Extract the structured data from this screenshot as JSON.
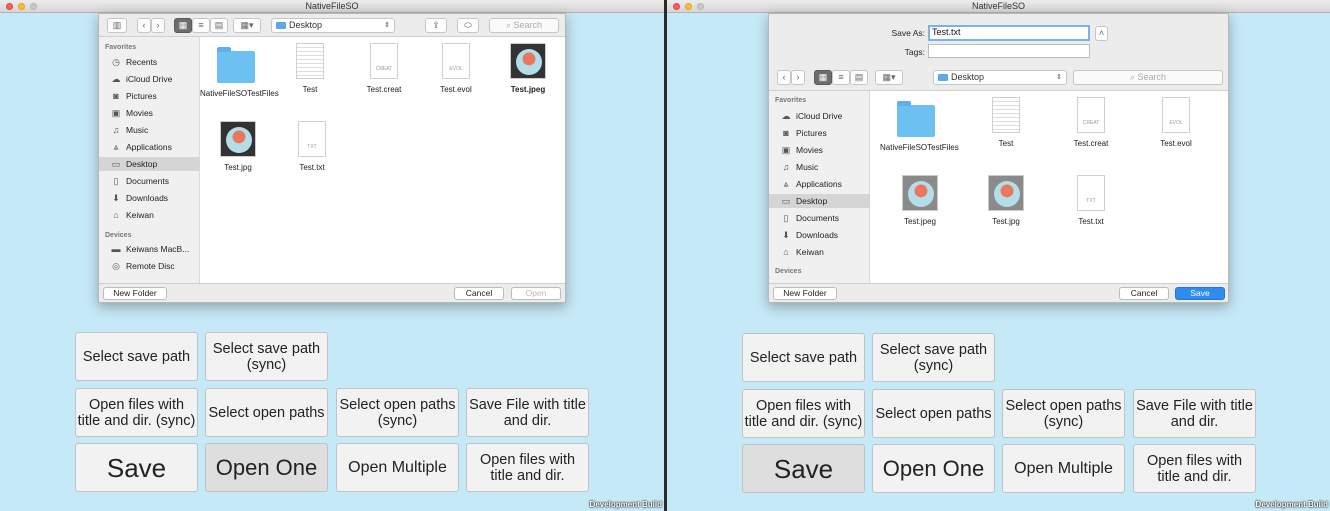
{
  "app_title": "NativeFileSO",
  "dev_build": "Development Build",
  "open_dialog": {
    "location": "Desktop",
    "search_placeholder": "Search",
    "sidebar": {
      "favorites_header": "Favorites",
      "favorites": [
        "Recents",
        "iCloud Drive",
        "Pictures",
        "Movies",
        "Music",
        "Applications",
        "Desktop",
        "Documents",
        "Downloads",
        "Keiwan"
      ],
      "devices_header": "Devices",
      "devices": [
        "Keiwans MacB...",
        "Remote Disc"
      ]
    },
    "files": [
      "NativeFileSOTestFiles",
      "Test",
      "Test.creat",
      "Test.evol",
      "Test.jpeg",
      "Test.jpg",
      "Test.txt"
    ],
    "new_folder": "New Folder",
    "cancel": "Cancel",
    "open": "Open"
  },
  "save_dialog": {
    "save_as_label": "Save As:",
    "save_as_value": "Test.txt",
    "tags_label": "Tags:",
    "location": "Desktop",
    "search_placeholder": "Search",
    "sidebar": {
      "favorites_header": "Favorites",
      "favorites": [
        "iCloud Drive",
        "Pictures",
        "Movies",
        "Music",
        "Applications",
        "Desktop",
        "Documents",
        "Downloads",
        "Keiwan"
      ],
      "devices_header": "Devices"
    },
    "files": [
      "NativeFileSOTestFiles",
      "Test",
      "Test.creat",
      "Test.evol",
      "Test.jpeg",
      "Test.jpg",
      "Test.txt"
    ],
    "new_folder": "New Folder",
    "cancel": "Cancel",
    "save": "Save"
  },
  "doc_icon_labels": {
    "creat": "CREAT",
    "evol": "EVOL",
    "txt": "TXT"
  },
  "buttons": {
    "select_save_path": "Select save path",
    "select_save_path_sync": "Select save path (sync)",
    "open_files_title_dir_sync": "Open files with title and dir. (sync)",
    "select_open_paths": "Select open paths",
    "select_open_paths_sync": "Select open paths (sync)",
    "save_file_title_dir": "Save File with title and dir.",
    "save": "Save",
    "open_one": "Open One",
    "open_multiple": "Open Multiple",
    "open_files_title_dir": "Open files with title and dir."
  }
}
